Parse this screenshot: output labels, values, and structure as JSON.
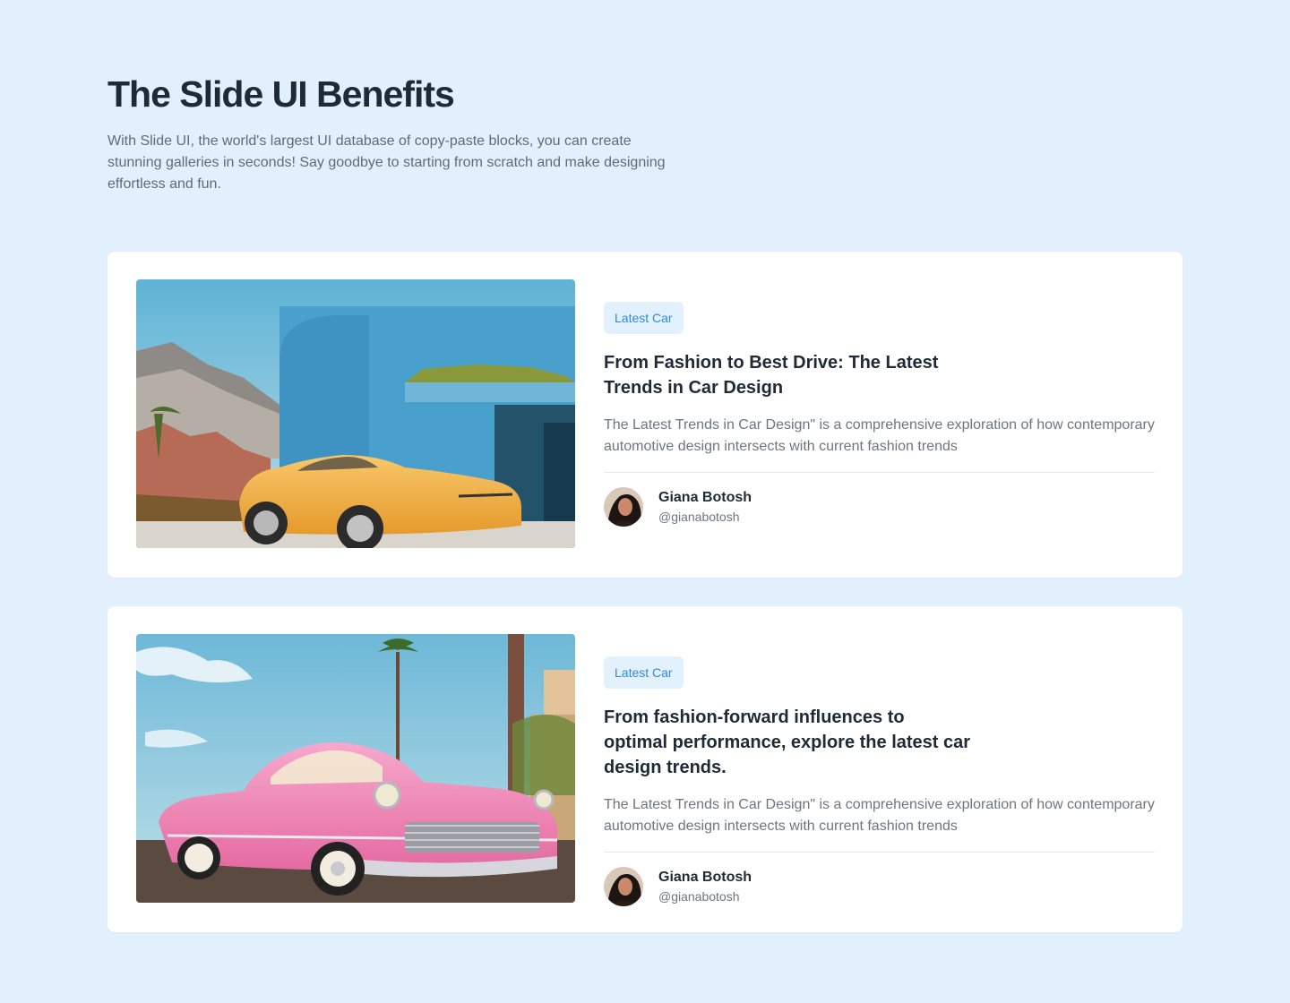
{
  "header": {
    "title": "The Slide UI Benefits",
    "subtitle": "With Slide UI, the world's largest UI database of copy-paste blocks, you can create stunning galleries in seconds! Say goodbye to starting from scratch and make designing effortless and fun."
  },
  "cards": [
    {
      "tag": "Latest Car",
      "title": "From Fashion to Best Drive: The Latest Trends in Car Design",
      "description": "The Latest Trends in Car Design\" is a comprehensive exploration of how contemporary automotive design intersects with current fashion trends",
      "author": {
        "name": "Giana Botosh",
        "handle": "@gianabotosh"
      },
      "image": "yellow-sports-car-photo"
    },
    {
      "tag": "Latest Car",
      "title": "From fashion-forward influences to optimal performance, explore the latest car design trends.",
      "description": "The Latest Trends in Car Design\" is a comprehensive exploration of how contemporary automotive design intersects with current fashion trends",
      "author": {
        "name": "Giana Botosh",
        "handle": "@gianabotosh"
      },
      "image": "pink-classic-car-photo"
    }
  ],
  "colors": {
    "background": "#e2f0fd",
    "card": "#ffffff",
    "tag_bg": "#e3f1fd",
    "tag_text": "#2f8adf",
    "heading": "#1f2a37"
  }
}
